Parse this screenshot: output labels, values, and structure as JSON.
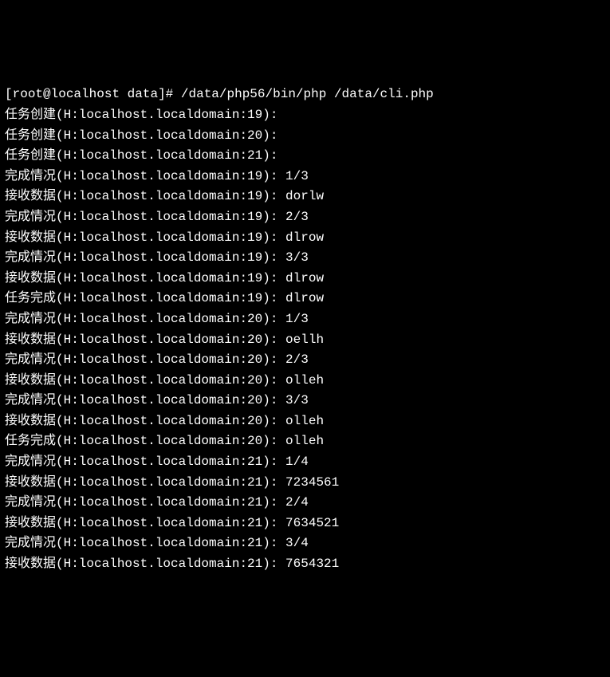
{
  "prompt": {
    "user": "root",
    "host": "localhost",
    "cwd": "data",
    "symbol": "#",
    "command": "/data/php56/bin/php /data/cli.php"
  },
  "lines": [
    {
      "text": "任务创建(H:localhost.localdomain:19):"
    },
    {
      "text": "任务创建(H:localhost.localdomain:20):"
    },
    {
      "text": "任务创建(H:localhost.localdomain:21):"
    },
    {
      "text": "完成情况(H:localhost.localdomain:19): 1/3"
    },
    {
      "text": "接收数据(H:localhost.localdomain:19): dorlw"
    },
    {
      "text": "完成情况(H:localhost.localdomain:19): 2/3"
    },
    {
      "text": "接收数据(H:localhost.localdomain:19): dlrow"
    },
    {
      "text": "完成情况(H:localhost.localdomain:19): 3/3"
    },
    {
      "text": "接收数据(H:localhost.localdomain:19): dlrow"
    },
    {
      "text": "任务完成(H:localhost.localdomain:19): dlrow"
    },
    {
      "text": "完成情况(H:localhost.localdomain:20): 1/3"
    },
    {
      "text": "接收数据(H:localhost.localdomain:20): oellh"
    },
    {
      "text": "完成情况(H:localhost.localdomain:20): 2/3"
    },
    {
      "text": "接收数据(H:localhost.localdomain:20): olleh"
    },
    {
      "text": "完成情况(H:localhost.localdomain:20): 3/3"
    },
    {
      "text": "接收数据(H:localhost.localdomain:20): olleh"
    },
    {
      "text": "任务完成(H:localhost.localdomain:20): olleh"
    },
    {
      "text": "完成情况(H:localhost.localdomain:21): 1/4"
    },
    {
      "text": "接收数据(H:localhost.localdomain:21): 7234561"
    },
    {
      "text": "完成情况(H:localhost.localdomain:21): 2/4"
    },
    {
      "text": "接收数据(H:localhost.localdomain:21): 7634521"
    },
    {
      "text": "完成情况(H:localhost.localdomain:21): 3/4"
    },
    {
      "text": "接收数据(H:localhost.localdomain:21): 7654321"
    }
  ]
}
